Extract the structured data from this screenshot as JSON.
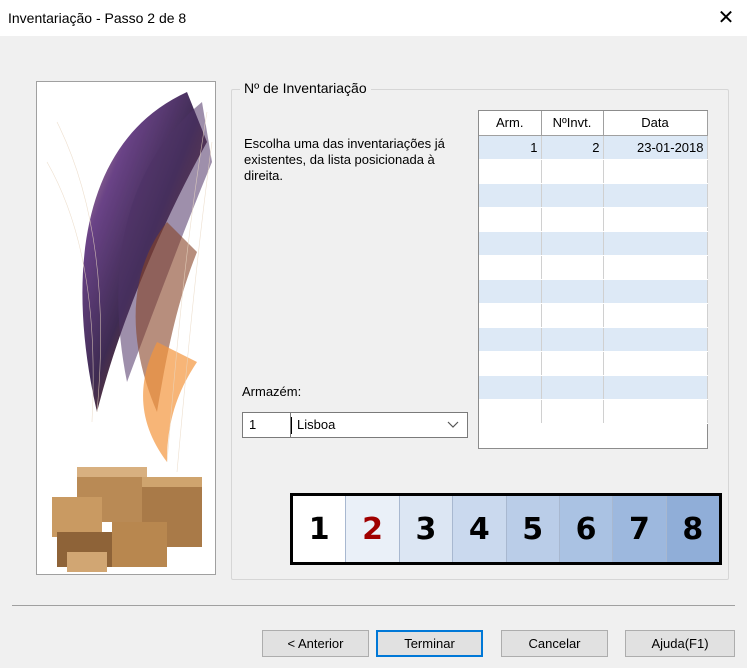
{
  "window": {
    "title": "Inventariação - Passo 2 de 8",
    "close_glyph": "✕"
  },
  "group": {
    "legend": "Nº de Inventariação"
  },
  "description": "Escolha uma das inventariações já existentes, da lista posicionada à direita.",
  "grid": {
    "columns": [
      "Arm.",
      "NºInvt.",
      "Data"
    ],
    "rows": [
      {
        "arm": "1",
        "invt": "2",
        "data": "23-01-2018"
      }
    ],
    "empty_rows": 11
  },
  "warehouse": {
    "label": "Armazém:",
    "code": "1",
    "name": "Lisboa"
  },
  "steps": [
    {
      "label": "1",
      "color": "#000000",
      "bg": "#ffffff"
    },
    {
      "label": "2",
      "color": "#a00000",
      "bg": "#eaf0f8"
    },
    {
      "label": "3",
      "color": "#000000",
      "bg": "#dce6f3"
    },
    {
      "label": "4",
      "color": "#000000",
      "bg": "#cad9ee"
    },
    {
      "label": "5",
      "color": "#000000",
      "bg": "#bacde8"
    },
    {
      "label": "6",
      "color": "#000000",
      "bg": "#aac2e3"
    },
    {
      "label": "7",
      "color": "#000000",
      "bg": "#9db8de"
    },
    {
      "label": "8",
      "color": "#000000",
      "bg": "#90aed8"
    }
  ],
  "buttons": {
    "previous": "< Anterior",
    "finish": "Terminar",
    "cancel": "Cancelar",
    "help": "Ajuda(F1)"
  }
}
